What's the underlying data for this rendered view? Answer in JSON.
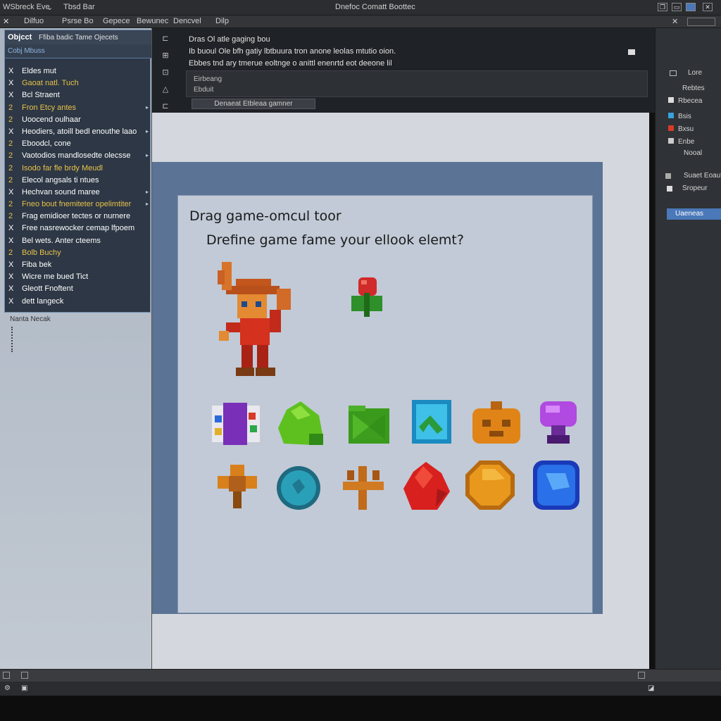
{
  "window": {
    "title": "Dnefoc Comatt Boottec",
    "left_title": "WSbreck Eve",
    "left_menu": "Tbsd Bar",
    "controls": [
      "❐",
      "▭",
      "✕"
    ]
  },
  "menubar": {
    "items": [
      "Dilfuo",
      "Psrse Bo",
      "Gepece",
      "Bewunec",
      "Dencvel",
      "Dilp"
    ],
    "right_close": "✕"
  },
  "objects_panel": {
    "title": "Objcct",
    "subtitle": "Ffiba badic Tame Ojecets",
    "search_label": "Cobj Mbuss",
    "items": [
      {
        "marker": "X",
        "label": "Eldes mut"
      },
      {
        "marker": "X",
        "label": "Gaoat natl. Tuch"
      },
      {
        "marker": "X",
        "label": "Bcl Straent"
      },
      {
        "marker": "2",
        "label": "Fron Etcy antes"
      },
      {
        "marker": "2",
        "label": "Uoocend oulhaar"
      },
      {
        "marker": "X",
        "label": "Heodiers, atoill bedl enouthe laao"
      },
      {
        "marker": "2",
        "label": "Eboodcl, cone"
      },
      {
        "marker": "2",
        "label": "Vaotodios mandlosedte olecsse"
      },
      {
        "marker": "2",
        "label": "Isodo far fle brdy Meudl"
      },
      {
        "marker": "2",
        "label": "Elecol angsals ti ntues"
      },
      {
        "marker": "X",
        "label": "Hechvan sound maree"
      },
      {
        "marker": "2",
        "label": "Fneo bout fnemiteter opelimtiter"
      },
      {
        "marker": "2",
        "label": "Frag emidioer tectes or nurnere"
      },
      {
        "marker": "X",
        "label": "Free nasrewocker cemap lfpoem"
      },
      {
        "marker": "X",
        "label": "Bel wets. Anter cteems"
      },
      {
        "marker": "2",
        "label": "Bolb Buchy"
      },
      {
        "marker": "X",
        "label": "Fiba bek"
      },
      {
        "marker": "X",
        "label": "Wicre me bued Tict"
      },
      {
        "marker": "X",
        "label": "Gleott Fnoftent"
      },
      {
        "marker": "X",
        "label": "dett langeck"
      }
    ],
    "footer_label": "Nanta Necak"
  },
  "properties": {
    "lines": [
      "Dras Ol atle gaging bou",
      "Ib buoul Ole bfh gatiy lbtbuura tron anone leolas mtutio oion.",
      "Ebbes tnd ary tmerue eoltnge o anittl enenrtd eot deeone lil"
    ],
    "box_label": "Eirbeang",
    "box_value": "Ebduit",
    "button_label": "Denaeat Etbleaa gamner"
  },
  "canvas": {
    "title": "Drag game-omcul toor",
    "subtitle": "Drefine game fame your  ellook elemt?"
  },
  "sprites": [
    {
      "name": "hero-sprite",
      "kind": "hero"
    },
    {
      "name": "berry-sprite",
      "kind": "berry"
    },
    {
      "name": "purple-crate-sprite",
      "kind": "crate"
    },
    {
      "name": "green-bush-sprite",
      "kind": "bush"
    },
    {
      "name": "green-block-sprite",
      "kind": "block"
    },
    {
      "name": "blue-tile-sprite",
      "kind": "bluetile"
    },
    {
      "name": "orange-chest-sprite",
      "kind": "chest"
    },
    {
      "name": "purple-mushroom-sprite",
      "kind": "mushroom"
    },
    {
      "name": "bronze-flower-sprite",
      "kind": "flower"
    },
    {
      "name": "teal-orb-sprite",
      "kind": "orb"
    },
    {
      "name": "wood-cross-sprite",
      "kind": "cross"
    },
    {
      "name": "red-crystal-sprite",
      "kind": "crystal"
    },
    {
      "name": "gold-coin-sprite",
      "kind": "coin"
    },
    {
      "name": "blue-gem-sprite",
      "kind": "gem"
    }
  ],
  "right_panel": {
    "items": [
      {
        "label": "Lore"
      },
      {
        "label": "Rebtes"
      },
      {
        "label": "Rbecea"
      },
      {
        "label": "Bsis"
      },
      {
        "label": "Bxsu"
      },
      {
        "label": "Enbe"
      },
      {
        "label": "Nooal"
      },
      {
        "label": "Suaet Eoaut"
      },
      {
        "label": "Sropeur"
      },
      {
        "label": "Uaeneas"
      }
    ]
  },
  "colors": {
    "accent": "#6c8bb0",
    "selected": "#4a78b8",
    "marker": "#e8c24a"
  }
}
